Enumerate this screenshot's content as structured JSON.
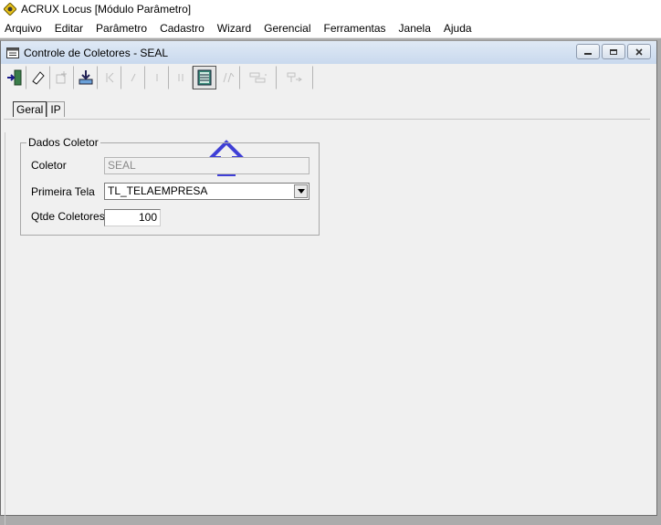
{
  "app": {
    "title": "ACRUX Locus [Módulo Parâmetro]"
  },
  "menu": [
    "Arquivo",
    "Editar",
    "Parâmetro",
    "Cadastro",
    "Wizard",
    "Gerencial",
    "Ferramentas",
    "Janela",
    "Ajuda"
  ],
  "window": {
    "title": "Controle de Coletores - SEAL"
  },
  "toolbar": {
    "buttons": [
      {
        "icon": "exit-door-icon",
        "enabled": true
      },
      {
        "icon": "eraser-icon",
        "enabled": true
      },
      {
        "icon": "new-record-icon",
        "enabled": false
      },
      {
        "icon": "save-download-icon",
        "enabled": true
      },
      {
        "icon": "first-record-icon",
        "enabled": false
      },
      {
        "icon": "prev-record-icon",
        "enabled": false
      },
      {
        "icon": "next-record-icon",
        "enabled": false
      },
      {
        "icon": "last-record-icon",
        "enabled": false
      },
      {
        "icon": "list-grid-icon",
        "enabled": true,
        "highlighted": true
      },
      {
        "icon": "find-icon",
        "enabled": false
      },
      {
        "icon": "report-icon",
        "enabled": false
      },
      {
        "icon": "export-icon",
        "enabled": false
      }
    ]
  },
  "tabs": [
    "Geral",
    "IP"
  ],
  "form": {
    "group_title": "Dados Coletor",
    "coletor_label": "Coletor",
    "coletor_value": "SEAL",
    "primeira_tela_label": "Primeira Tela",
    "primeira_tela_value": "TL_TELAEMPRESA",
    "qtde_label": "Qtde Coletores",
    "qtde_value": "100"
  },
  "colors": {
    "arrow": "#3f3fd6",
    "mdi_background": "#ababab"
  }
}
